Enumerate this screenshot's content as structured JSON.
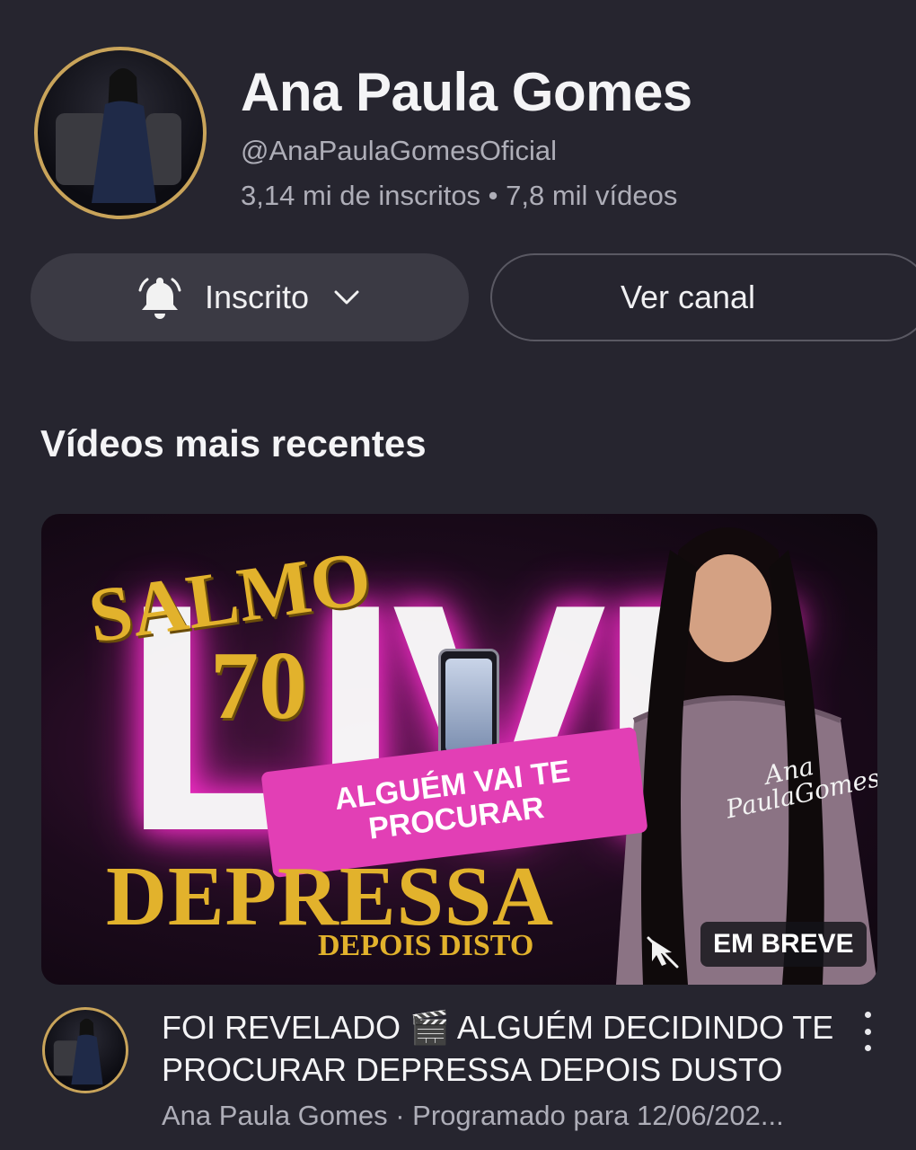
{
  "channel": {
    "name": "Ana Paula Gomes",
    "handle": "@AnaPaulaGomesOficial",
    "stats": "3,14 mi de inscritos • 7,8 mil vídeos"
  },
  "actions": {
    "subscribed_label": "Inscrito",
    "view_channel_label": "Ver canal"
  },
  "section": {
    "title": "Vídeos mais recentes"
  },
  "video": {
    "thumbnail": {
      "salmo": "SALMO",
      "number": "70",
      "live": "LIVE",
      "banner_line1": "ALGUÉM VAI TE",
      "banner_line2": "PROCURAR",
      "depressa": "DEPRESSA",
      "depois": "DEPOIS DISTO",
      "signature_line1": "Ana",
      "signature_line2": "PaulaGomes",
      "badge": "EM BREVE"
    },
    "title": "FOI REVELADO 🎬 ALGUÉM DECIDINDO TE PROCURAR DEPRESSA DEPOIS DUSTO",
    "meta": "Ana Paula Gomes · Programado para 12/06/202..."
  },
  "icons": {
    "bell": "bell-icon",
    "chevron": "chevron-down-icon",
    "more": "more-vert-icon",
    "mute": "mute-icon"
  },
  "colors": {
    "background": "#26252f",
    "accent_gold": "#e2b22c",
    "banner_pink": "#e23fb5"
  }
}
